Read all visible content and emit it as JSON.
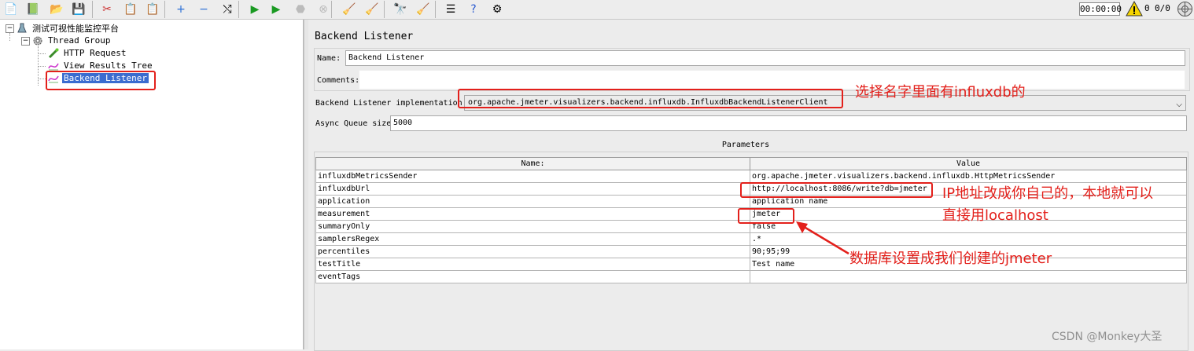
{
  "toolbar": {
    "timer": "00:00:00",
    "warning_count": "0",
    "thread_ratio": "0/0",
    "buttons": [
      {
        "name": "new-icon",
        "glyph": "📄"
      },
      {
        "name": "templates-icon",
        "glyph": "📗"
      },
      {
        "name": "open-icon",
        "glyph": "📂"
      },
      {
        "name": "save-icon",
        "glyph": "💾"
      },
      {
        "name": "cut-icon",
        "glyph": "✂"
      },
      {
        "name": "copy-icon",
        "glyph": "📋"
      },
      {
        "name": "paste-icon",
        "glyph": "📋"
      },
      {
        "name": "expand-icon",
        "glyph": "+"
      },
      {
        "name": "collapse-icon",
        "glyph": "−"
      },
      {
        "name": "toggle-icon",
        "glyph": "⤭"
      },
      {
        "name": "start-icon",
        "glyph": "▶"
      },
      {
        "name": "start-no-pauses-icon",
        "glyph": "▶"
      },
      {
        "name": "stop-icon",
        "glyph": "⬣"
      },
      {
        "name": "shutdown-icon",
        "glyph": "⊗"
      },
      {
        "name": "clear-icon",
        "glyph": "🧹"
      },
      {
        "name": "clear-all-icon",
        "glyph": "🧹"
      },
      {
        "name": "search-icon",
        "glyph": "🔭"
      },
      {
        "name": "reset-search-icon",
        "glyph": "🧹"
      },
      {
        "name": "function-helper-icon",
        "glyph": "☰"
      },
      {
        "name": "help-icon",
        "glyph": "?"
      },
      {
        "name": "remote-icon",
        "glyph": "⚙"
      }
    ]
  },
  "tree": {
    "root": "测试可视性能监控平台",
    "thread_group": "Thread Group",
    "http_request": "HTTP Request",
    "view_results_tree": "View Results Tree",
    "backend_listener": "Backend Listener"
  },
  "panel": {
    "title": "Backend Listener",
    "name_label": "Name:",
    "name_value": "Backend Listener",
    "comments_label": "Comments:",
    "impl_label": "Backend Listener implementation",
    "impl_value": "org.apache.jmeter.visualizers.backend.influxdb.InfluxdbBackendListenerClient",
    "queue_label": "Async Queue size",
    "queue_value": "5000",
    "params_title": "Parameters",
    "col_name": "Name:",
    "col_value": "Value",
    "rows": [
      {
        "name": "influxdbMetricsSender",
        "value": "org.apache.jmeter.visualizers.backend.influxdb.HttpMetricsSender"
      },
      {
        "name": "influxdbUrl",
        "value": "http://localhost:8086/write?db=jmeter"
      },
      {
        "name": "application",
        "value": "application name"
      },
      {
        "name": "measurement",
        "value": "jmeter"
      },
      {
        "name": "summaryOnly",
        "value": "false"
      },
      {
        "name": "samplersRegex",
        "value": ".*"
      },
      {
        "name": "percentiles",
        "value": "90;95;99"
      },
      {
        "name": "testTitle",
        "value": "Test name"
      },
      {
        "name": "eventTags",
        "value": ""
      }
    ]
  },
  "annotations": {
    "impl_note": "选择名字里面有influxdb的",
    "url_note_line1": "IP地址改成你自己的，本地就可以",
    "url_note_line2": "直接用localhost",
    "db_note": "数据库设置成我们创建的jmeter"
  },
  "watermark": "CSDN @Monkey大圣",
  "colors": {
    "annotation_red": "#e3201b",
    "selection_blue": "#3a6cd0"
  }
}
